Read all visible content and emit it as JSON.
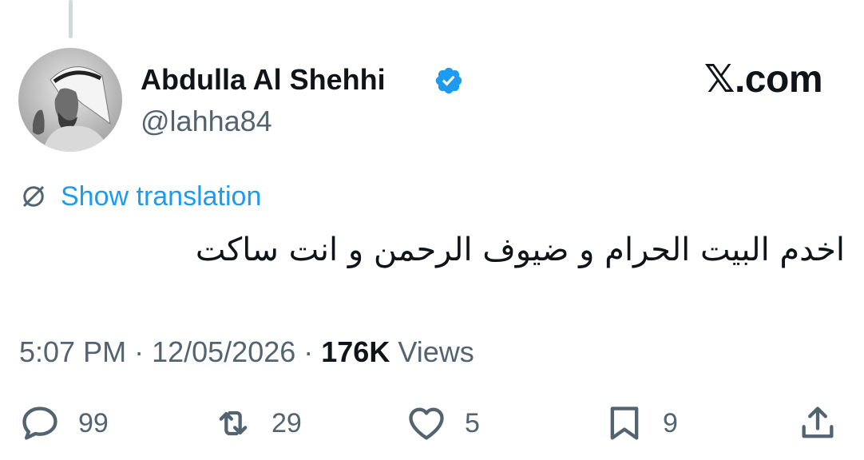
{
  "author": {
    "display_name": "Abdulla Al Shehhi",
    "handle": "@lahha84",
    "verified": true,
    "avatar_icon": "profile-photo"
  },
  "watermark": "𝕏.com",
  "translation": {
    "icon": "globe-icon",
    "label": "Show translation"
  },
  "tweet": {
    "text": "اخدم البيت الحرام و ضيوف الرحمن و انت ساكت"
  },
  "meta": {
    "time": "5:07 PM",
    "separator": " · ",
    "date": "12/05/2026",
    "separator2": " · ",
    "views_count": "176K",
    "views_label": " Views"
  },
  "actions": {
    "reply": {
      "icon": "reply-icon",
      "count": "99"
    },
    "repost": {
      "icon": "repost-icon",
      "count": "29"
    },
    "like": {
      "icon": "heart-icon",
      "count": "5"
    },
    "bookmark": {
      "icon": "bookmark-icon",
      "count": "9"
    },
    "share": {
      "icon": "share-icon"
    }
  },
  "colors": {
    "accent": "#1d9bf0",
    "text_primary": "#0f1419",
    "text_secondary": "#536471",
    "thread_line": "#cfd9de"
  }
}
